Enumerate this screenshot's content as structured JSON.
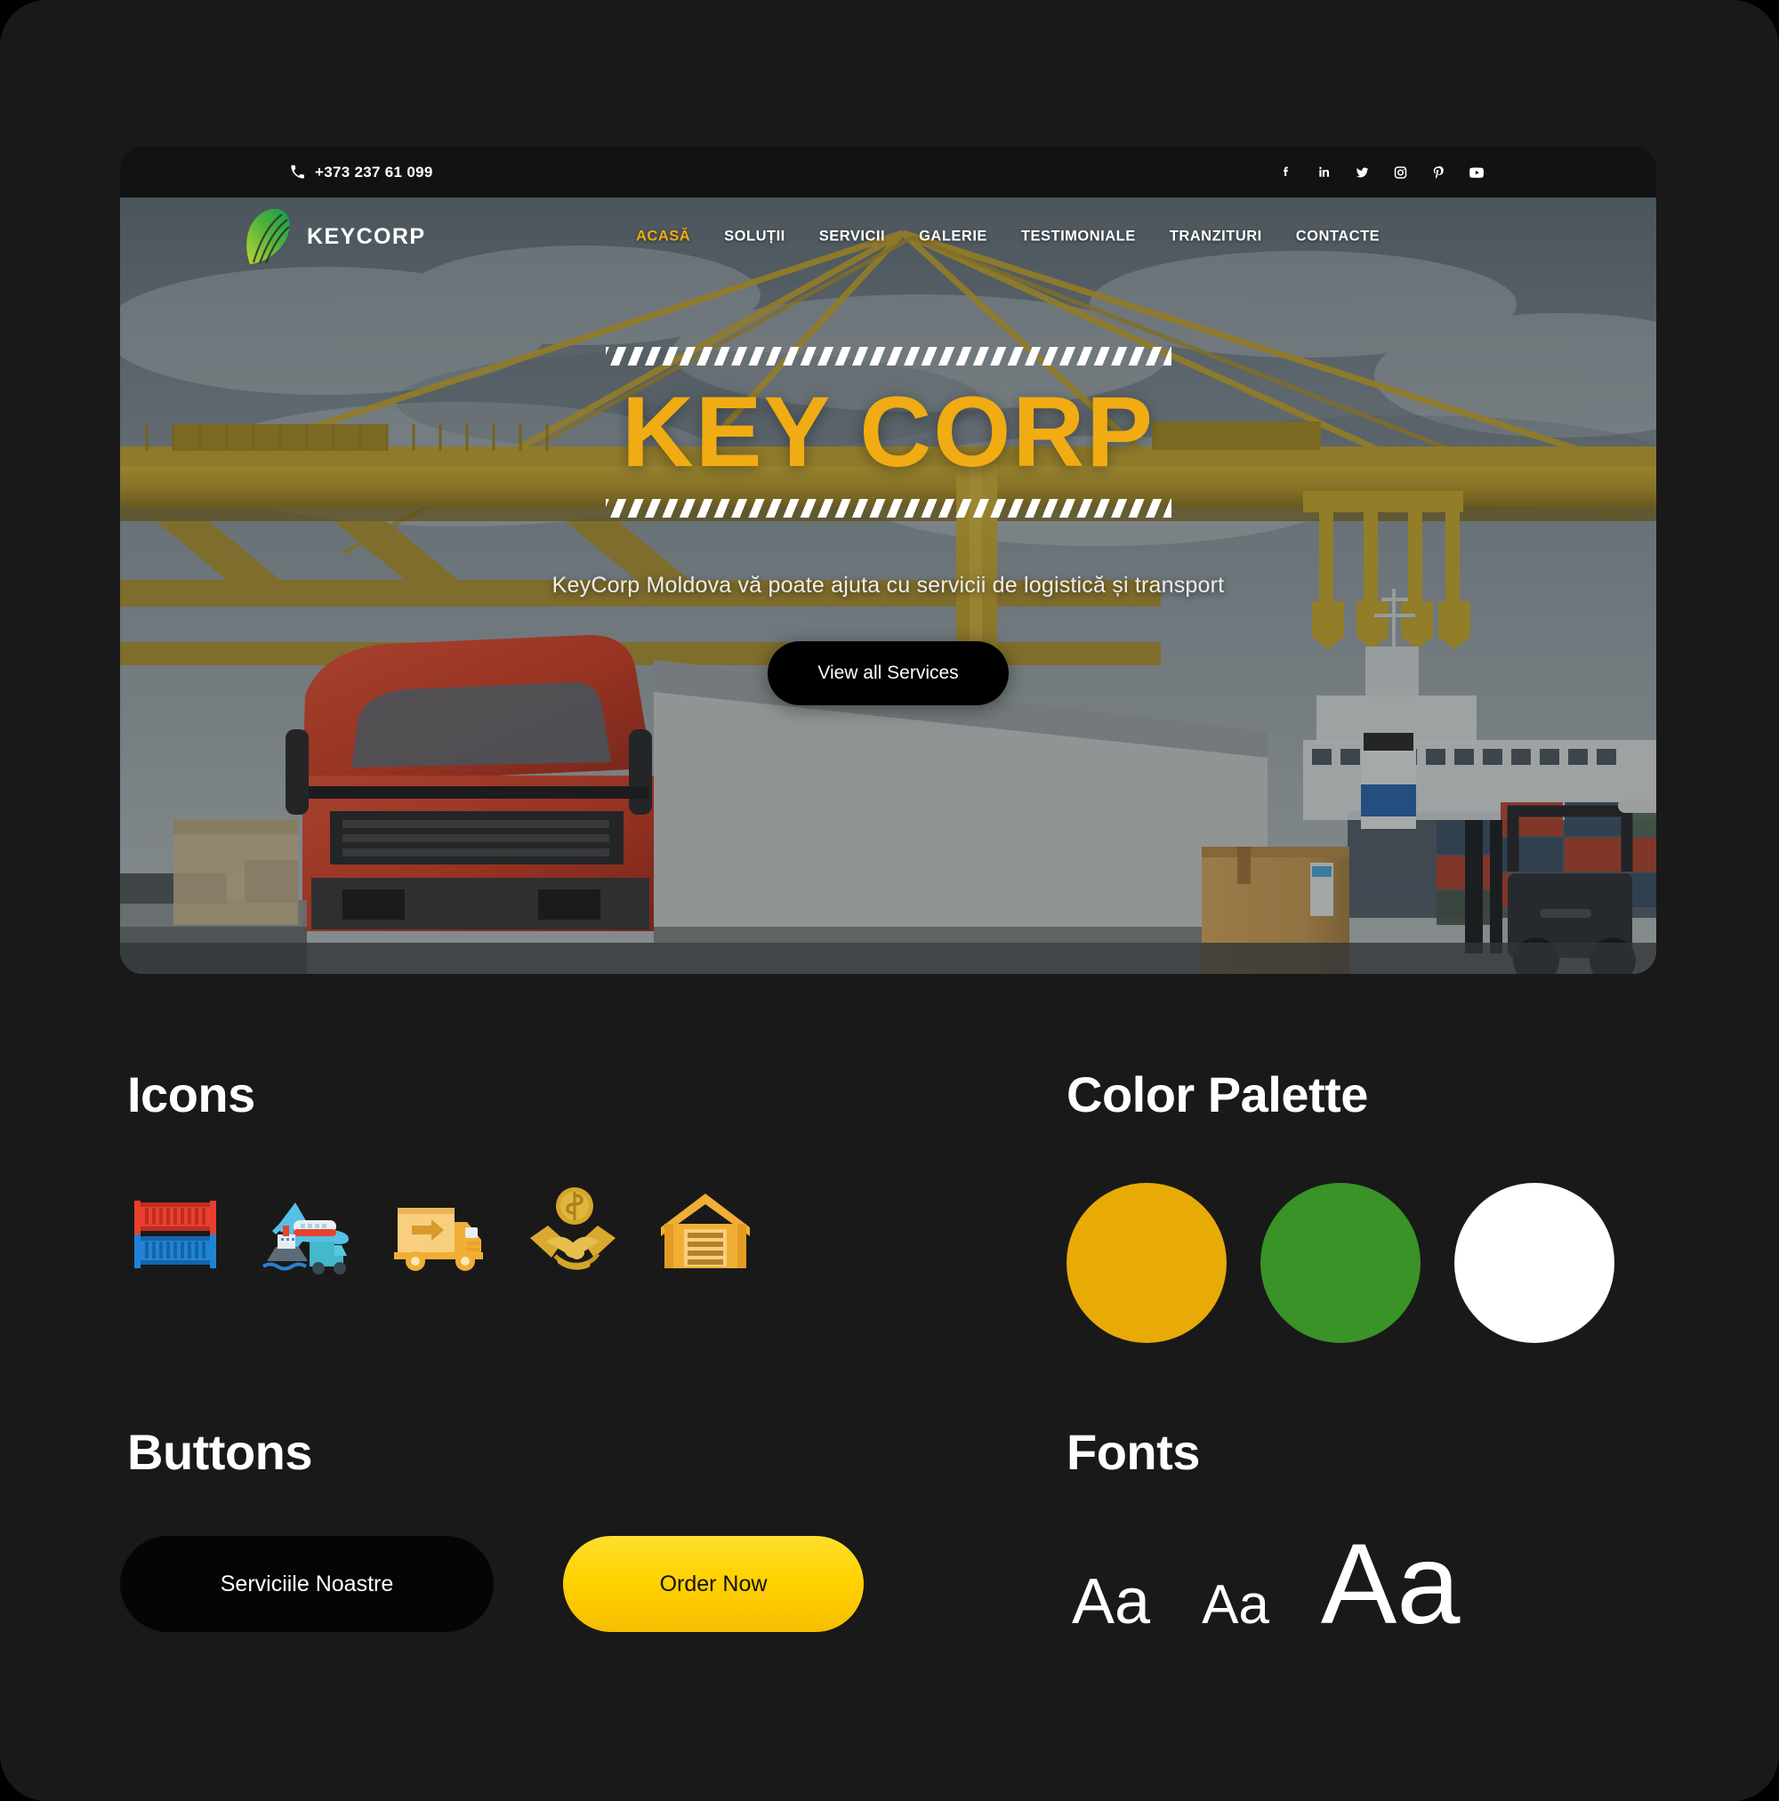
{
  "site": {
    "topbar": {
      "phone": "+373 237 61 099",
      "phone_icon": "phone-icon",
      "socials": [
        {
          "name": "facebook-icon",
          "label": "Facebook"
        },
        {
          "name": "linkedin-icon",
          "label": "LinkedIn"
        },
        {
          "name": "twitter-icon",
          "label": "Twitter"
        },
        {
          "name": "instagram-icon",
          "label": "Instagram"
        },
        {
          "name": "pinterest-icon",
          "label": "Pinterest"
        },
        {
          "name": "youtube-icon",
          "label": "YouTube"
        }
      ]
    },
    "brand": {
      "name": "KEYCORP",
      "logo_icon": "keycorp-leaf-logo"
    },
    "nav": {
      "items": [
        {
          "label": "ACASĂ",
          "active": true
        },
        {
          "label": "SOLUȚII",
          "active": false
        },
        {
          "label": "SERVICII",
          "active": false
        },
        {
          "label": "GALERIE",
          "active": false
        },
        {
          "label": "TESTIMONIALE",
          "active": false
        },
        {
          "label": "TRANZITURI",
          "active": false
        },
        {
          "label": "CONTACTE",
          "active": false
        }
      ]
    },
    "hero": {
      "title": "KEY CORP",
      "subtitle": "KeyCorp Moldova vă poate ajuta cu servicii de logistică și transport",
      "cta_label": "View all Services",
      "title_color": "#F0AC12",
      "background": "port-terminal-crane-truck-photo"
    }
  },
  "styleguide": {
    "icons": {
      "title": "Icons",
      "items": [
        {
          "name": "shipping-containers-icon"
        },
        {
          "name": "multimodal-transport-icon"
        },
        {
          "name": "delivery-truck-icon"
        },
        {
          "name": "handshake-deal-icon"
        },
        {
          "name": "warehouse-icon"
        }
      ]
    },
    "palette": {
      "title": "Color Palette",
      "swatches": [
        {
          "name": "amber",
          "hex": "#E8AB06"
        },
        {
          "name": "green",
          "hex": "#399326"
        },
        {
          "name": "white",
          "hex": "#FFFFFF"
        }
      ]
    },
    "buttons": {
      "title": "Buttons",
      "items": [
        {
          "label": "Serviciile Noastre",
          "style": "dark"
        },
        {
          "label": "Order Now",
          "style": "yellow"
        }
      ]
    },
    "fonts": {
      "title": "Fonts",
      "samples": [
        "Aa",
        "Aa",
        "Aa"
      ]
    }
  }
}
